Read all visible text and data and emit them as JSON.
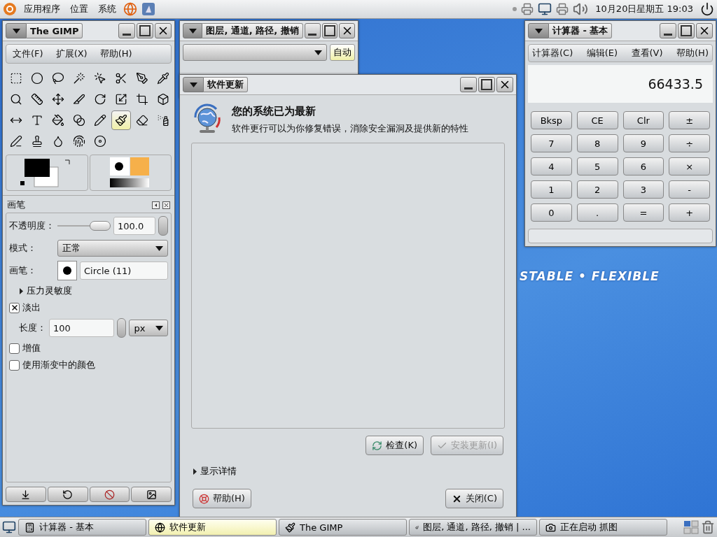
{
  "top_panel": {
    "menus": [
      "应用程序",
      "位置",
      "系统"
    ],
    "clock": "10月20日星期五 19:03"
  },
  "wallpaper": {
    "slogan": "STABLE • FLEXIBLE"
  },
  "gimp": {
    "title": "The GIMP",
    "menu": [
      "文件(F)",
      "扩展(X)",
      "帮助(H)"
    ],
    "tools": [
      {
        "selected": false
      },
      {
        "selected": false
      },
      {
        "selected": false
      },
      {
        "selected": false
      },
      {
        "selected": false
      },
      {
        "selected": false
      },
      {
        "selected": false
      },
      {
        "selected": false
      },
      {
        "selected": false
      },
      {
        "selected": false
      },
      {
        "selected": false
      },
      {
        "selected": false
      },
      {
        "selected": false
      },
      {
        "selected": false
      },
      {
        "selected": false
      },
      {
        "selected": false
      },
      {
        "selected": false
      },
      {
        "selected": false
      },
      {
        "selected": false
      },
      {
        "selected": false
      },
      {
        "selected": false
      },
      {
        "selected": true
      },
      {
        "selected": false
      },
      {
        "selected": false
      },
      {
        "selected": false
      },
      {
        "selected": false
      },
      {
        "selected": false
      },
      {
        "selected": false
      },
      {
        "selected": false
      }
    ],
    "options": {
      "title": "画笔",
      "opacity_label": "不透明度：",
      "opacity": {
        "level": 1.0
      },
      "opacity_value": "100.0",
      "mode_label": "模式：",
      "mode": "正常",
      "brush_label": "画笔：",
      "brush": "Circle (11)",
      "pressure": {
        "label": "压力灵敏度",
        "expanded": false
      },
      "fade": {
        "label": "淡出",
        "checked": true
      },
      "length_label": "长度：",
      "length": "100",
      "unit": "px",
      "incremental": {
        "label": "增值",
        "checked": false
      },
      "gradient_colors": {
        "label": "使用渐变中的颜色",
        "checked": false
      }
    }
  },
  "layers": {
    "title": "图层, 通道, 路径, 撤销",
    "auto_button": "自动"
  },
  "update": {
    "title": "软件更新",
    "heading": "您的系统已为最新",
    "description": "软件更行可以为你修复错误，消除安全漏洞及提供新的特性",
    "check_button": {
      "label": "检查(K)",
      "disabled": false
    },
    "install_button": {
      "label": "安装更新(I)",
      "disabled": true
    },
    "details": {
      "label": "显示详情",
      "expanded": false
    },
    "help_button": "帮助(H)",
    "close_button": "关闭(C)"
  },
  "calculator": {
    "title": "计算器  - 基本",
    "menu": [
      "计算器(C)",
      "编辑(E)",
      "查看(V)",
      "帮助(H)"
    ],
    "display": "66433.5",
    "keys": [
      [
        "Bksp",
        "CE",
        "Clr",
        "±"
      ],
      [
        "7",
        "8",
        "9",
        "÷"
      ],
      [
        "4",
        "5",
        "6",
        "×"
      ],
      [
        "1",
        "2",
        "3",
        "-"
      ],
      [
        "0",
        ".",
        "=",
        "+"
      ]
    ]
  },
  "taskbar": [
    {
      "label": "计算器  - 基本",
      "kind": "calculator",
      "selected": false
    },
    {
      "label": "软件更新",
      "kind": "update",
      "selected": true
    },
    {
      "label": "The GIMP",
      "kind": "gimp",
      "selected": false
    },
    {
      "label": "图层, 通道, 路径, 撤销 | ...",
      "kind": "gimp",
      "selected": false
    },
    {
      "label": "正在启动 抓图",
      "kind": "camera",
      "selected": false
    }
  ]
}
